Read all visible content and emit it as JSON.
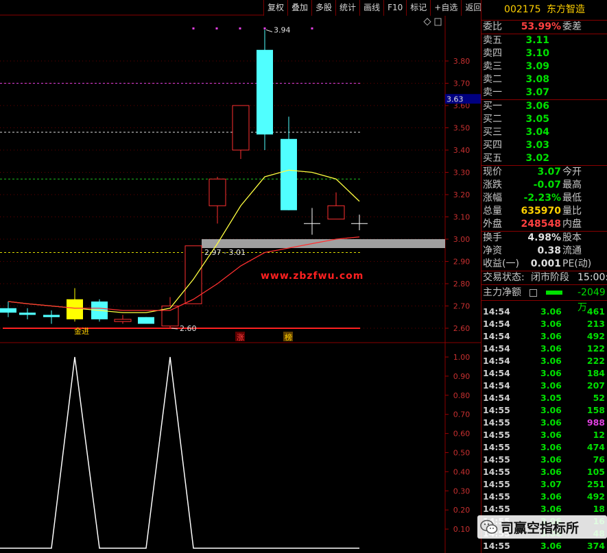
{
  "toolbar": [
    "复权",
    "叠加",
    "多股",
    "统计",
    "画线",
    "F10",
    "标记",
    "+自选",
    "返回"
  ],
  "stock": {
    "code": "002175",
    "name": "东方智造"
  },
  "weibi": {
    "label": "委比",
    "value": "53.99%",
    "label2": "委差"
  },
  "sell": [
    {
      "label": "卖五",
      "price": "3.11"
    },
    {
      "label": "卖四",
      "price": "3.10"
    },
    {
      "label": "卖三",
      "price": "3.09"
    },
    {
      "label": "卖二",
      "price": "3.08"
    },
    {
      "label": "卖一",
      "price": "3.07"
    }
  ],
  "buy": [
    {
      "label": "买一",
      "price": "3.06"
    },
    {
      "label": "买二",
      "price": "3.05"
    },
    {
      "label": "买三",
      "price": "3.04"
    },
    {
      "label": "买四",
      "price": "3.03"
    },
    {
      "label": "买五",
      "price": "3.02"
    }
  ],
  "quote": [
    {
      "label": "现价",
      "value": "3.07",
      "label2": "今开",
      "color": "#00e000"
    },
    {
      "label": "涨跌",
      "value": "-0.07",
      "label2": "最高",
      "color": "#00e000"
    },
    {
      "label": "涨幅",
      "value": "-2.23%",
      "label2": "最低",
      "color": "#00e000"
    },
    {
      "label": "总量",
      "value": "635970",
      "label2": "量比",
      "color": "#ffd000"
    },
    {
      "label": "外盘",
      "value": "248548",
      "label2": "内盘",
      "color": "#ff4040"
    }
  ],
  "fund": [
    {
      "label": "换手",
      "value": "4.98%",
      "label2": "股本"
    },
    {
      "label": "净资",
      "value": "0.38",
      "label2": "流通"
    },
    {
      "label": "收益(一)",
      "value": "0.001",
      "label2": "PE(动)"
    }
  ],
  "status": {
    "label": "交易状态:",
    "value": "闭市阶段",
    "time": "15:00:0"
  },
  "main_force": {
    "label": "主力净额",
    "value": "-2049万"
  },
  "trades": [
    {
      "t": "14:54",
      "p": "3.06",
      "v": "461",
      "pc": "#00e000",
      "vc": "#00e000"
    },
    {
      "t": "14:54",
      "p": "3.06",
      "v": "213",
      "pc": "#00e000",
      "vc": "#00e000"
    },
    {
      "t": "14:54",
      "p": "3.06",
      "v": "492",
      "pc": "#00e000",
      "vc": "#00e000"
    },
    {
      "t": "14:54",
      "p": "3.06",
      "v": "122",
      "pc": "#00e000",
      "vc": "#00e000"
    },
    {
      "t": "14:54",
      "p": "3.06",
      "v": "222",
      "pc": "#00e000",
      "vc": "#00e000"
    },
    {
      "t": "14:54",
      "p": "3.06",
      "v": "184",
      "pc": "#00e000",
      "vc": "#00e000"
    },
    {
      "t": "14:54",
      "p": "3.06",
      "v": "207",
      "pc": "#00e000",
      "vc": "#00e000"
    },
    {
      "t": "14:54",
      "p": "3.05",
      "v": "52",
      "pc": "#00e000",
      "vc": "#00e000"
    },
    {
      "t": "14:55",
      "p": "3.06",
      "v": "158",
      "pc": "#00e000",
      "vc": "#00e000"
    },
    {
      "t": "14:55",
      "p": "3.06",
      "v": "988",
      "pc": "#00e000",
      "vc": "#e040e0"
    },
    {
      "t": "14:55",
      "p": "3.06",
      "v": "12",
      "pc": "#00e000",
      "vc": "#00e000"
    },
    {
      "t": "14:55",
      "p": "3.06",
      "v": "474",
      "pc": "#00e000",
      "vc": "#00e000"
    },
    {
      "t": "14:55",
      "p": "3.06",
      "v": "76",
      "pc": "#00e000",
      "vc": "#00e000"
    },
    {
      "t": "14:55",
      "p": "3.06",
      "v": "105",
      "pc": "#00e000",
      "vc": "#00e000"
    },
    {
      "t": "14:55",
      "p": "3.07",
      "v": "251",
      "pc": "#00e000",
      "vc": "#00e000"
    },
    {
      "t": "14:55",
      "p": "3.06",
      "v": "492",
      "pc": "#00e000",
      "vc": "#00e000"
    },
    {
      "t": "14:55",
      "p": "3.06",
      "v": "18",
      "pc": "#00e000",
      "vc": "#00e000"
    },
    {
      "t": "14:55",
      "p": "3.06",
      "v": "16",
      "pc": "#00e000",
      "vc": "#00e000"
    },
    {
      "t": "14:55",
      "p": "3.06",
      "v": "48",
      "pc": "#00e000",
      "vc": "#00e000"
    },
    {
      "t": "14:55",
      "p": "3.06",
      "v": "374",
      "pc": "#00e000",
      "vc": "#00e000"
    }
  ],
  "price_axis": [
    "3.80",
    "3.70",
    "3.60",
    "3.50",
    "3.40",
    "3.30",
    "3.20",
    "3.10",
    "3.00",
    "2.90",
    "2.80",
    "2.70",
    "2.60"
  ],
  "price_current": "3.63",
  "ind_axis": [
    "1.00",
    "0.90",
    "0.80",
    "0.70",
    "0.60",
    "0.50",
    "0.40",
    "0.30",
    "0.20",
    "0.10"
  ],
  "annotations": {
    "high": "3.94",
    "low": "2.60",
    "zone": "2.97 - 3.01",
    "enter": "金进",
    "zhang": "涨",
    "bang": "榜"
  },
  "watermark": "www.zbzfwu.com",
  "wechat": "司赢空指标所",
  "chart_data": {
    "type": "candlestick",
    "candles": [
      {
        "o": 2.69,
        "c": 2.67,
        "h": 2.72,
        "l": 2.65,
        "color": "cyan"
      },
      {
        "o": 2.67,
        "c": 2.66,
        "h": 2.69,
        "l": 2.64,
        "color": "cyan"
      },
      {
        "o": 2.66,
        "c": 2.65,
        "h": 2.68,
        "l": 2.62,
        "color": "cyan"
      },
      {
        "o": 2.64,
        "c": 2.73,
        "h": 2.78,
        "l": 2.63,
        "color": "yellow"
      },
      {
        "o": 2.72,
        "c": 2.64,
        "h": 2.73,
        "l": 2.63,
        "color": "cyan"
      },
      {
        "o": 2.63,
        "c": 2.64,
        "h": 2.66,
        "l": 2.62,
        "color": "red"
      },
      {
        "o": 2.65,
        "c": 2.62,
        "h": 2.65,
        "l": 2.62,
        "color": "cyan"
      },
      {
        "o": 2.61,
        "c": 2.7,
        "h": 2.74,
        "l": 2.6,
        "color": "red"
      },
      {
        "o": 2.71,
        "c": 2.97,
        "h": 2.97,
        "l": 2.71,
        "color": "red"
      },
      {
        "o": 3.15,
        "c": 3.27,
        "h": 3.28,
        "l": 3.07,
        "color": "red"
      },
      {
        "o": 3.4,
        "c": 3.6,
        "h": 3.6,
        "l": 3.36,
        "color": "red"
      },
      {
        "o": 3.85,
        "c": 3.47,
        "h": 3.94,
        "l": 3.4,
        "color": "cyan"
      },
      {
        "o": 3.45,
        "c": 3.13,
        "h": 3.55,
        "l": 3.13,
        "color": "cyan"
      },
      {
        "o": 3.07,
        "c": 3.07,
        "h": 3.14,
        "l": 3.02,
        "color": "white"
      },
      {
        "o": 3.09,
        "c": 3.15,
        "h": 3.21,
        "l": 3.09,
        "color": "red"
      },
      {
        "o": 3.07,
        "c": 3.07,
        "h": 3.11,
        "l": 3.04,
        "color": "white"
      }
    ],
    "ma_yellow": [
      2.72,
      2.71,
      2.7,
      2.69,
      2.68,
      2.67,
      2.67,
      2.69,
      2.82,
      2.98,
      3.15,
      3.28,
      3.31,
      3.3,
      3.27,
      3.17
    ],
    "ma_red": [
      2.72,
      2.71,
      2.7,
      2.69,
      2.69,
      2.68,
      2.68,
      2.68,
      2.73,
      2.8,
      2.88,
      2.94,
      2.96,
      2.98,
      3.0,
      3.01
    ],
    "ylim": [
      2.55,
      3.98
    ],
    "indicator": [
      0,
      0,
      0,
      1,
      0,
      0,
      0,
      1,
      0,
      0,
      0,
      0,
      0,
      0,
      0,
      0
    ]
  }
}
